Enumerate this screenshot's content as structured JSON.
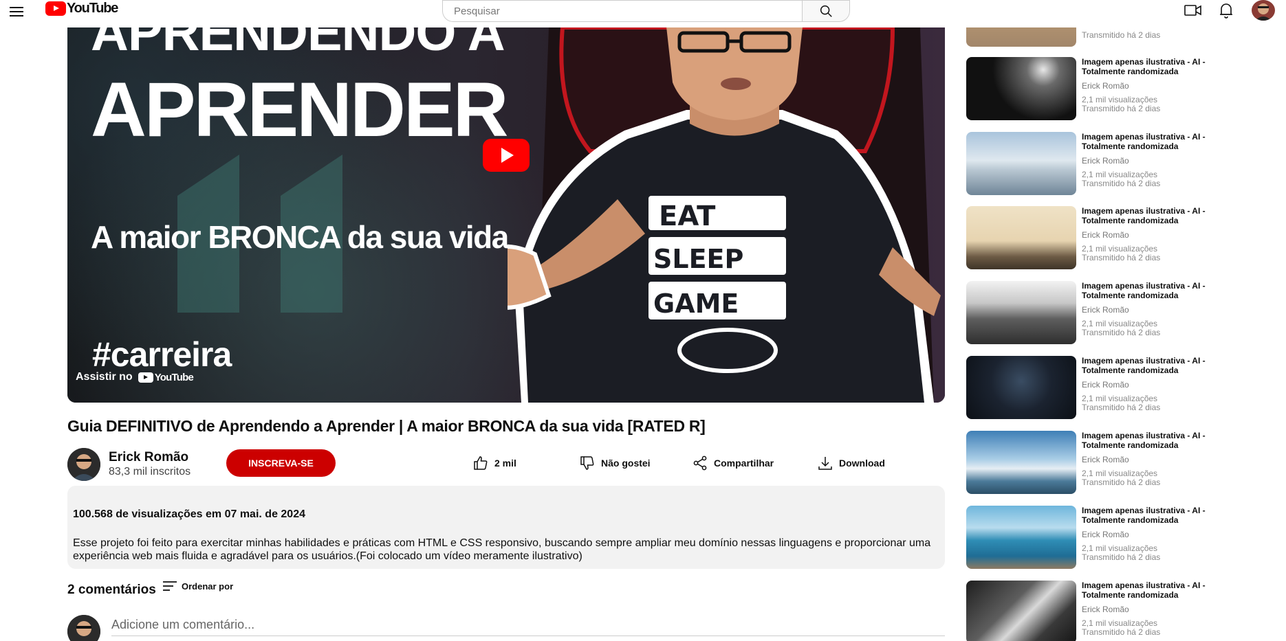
{
  "header": {
    "logo_text": "YouTube",
    "search_placeholder": "Pesquisar"
  },
  "player": {
    "thumb_line1": "APRENDENDO A",
    "thumb_line2": "APRENDER",
    "thumb_subtitle": "A maior BRONCA da sua vida",
    "thumb_hashtag": "#carreira",
    "shirt_text": [
      "EAT",
      "SLEEP",
      "GAME"
    ],
    "watch_on": "Assistir no",
    "watch_on_logo": "YouTube"
  },
  "video": {
    "title": "Guia DEFINITIVO de Aprendendo a Aprender | A maior BRONCA da sua vida [RATED R]",
    "channel_name": "Erick Romão",
    "subscribers": "83,3 mil inscritos",
    "subscribe_label": "INSCREVA-SE",
    "likes": "2 mil",
    "dislike_label": "Não gostei",
    "share_label": "Compartilhar",
    "download_label": "Download"
  },
  "description": {
    "meta": "100.568 de visualizações em 07 mai. de 2024",
    "text": "Esse projeto foi feito para exercitar minhas habilidades e práticas com HTML e CSS responsivo, buscando sempre ampliar meu domínio nessas linguagens e proporcionar uma experiência web mais fluida e agradável para os usuários.(Foi colocado um vídeo meramente ilustrativo)"
  },
  "comments": {
    "count": "2 comentários",
    "sort_label": "Ordenar por",
    "input_placeholder": "Adicione um comentário..."
  },
  "sidebar": {
    "items": [
      {
        "title": "",
        "channel": "",
        "views": "",
        "time": "Transmitido há 2 dias"
      },
      {
        "title": "Imagem apenas ilustrativa - AI - Totalmente randomizada",
        "channel": "Erick Romão",
        "views": "2,1 mil visualizações",
        "time": "Transmitido há 2 dias"
      },
      {
        "title": "Imagem apenas ilustrativa - AI - Totalmente randomizada",
        "channel": "Erick Romão",
        "views": "2,1 mil visualizações",
        "time": "Transmitido há 2 dias"
      },
      {
        "title": "Imagem apenas ilustrativa - AI - Totalmente randomizada",
        "channel": "Erick Romão",
        "views": "2,1 mil visualizações",
        "time": "Transmitido há 2 dias"
      },
      {
        "title": "Imagem apenas ilustrativa - AI - Totalmente randomizada",
        "channel": "Erick Romão",
        "views": "2,1 mil visualizações",
        "time": "Transmitido há 2 dias"
      },
      {
        "title": "Imagem apenas ilustrativa - AI - Totalmente randomizada",
        "channel": "Erick Romão",
        "views": "2,1 mil visualizações",
        "time": "Transmitido há 2 dias"
      },
      {
        "title": "Imagem apenas ilustrativa - AI - Totalmente randomizada",
        "channel": "Erick Romão",
        "views": "2,1 mil visualizações",
        "time": "Transmitido há 2 dias"
      },
      {
        "title": "Imagem apenas ilustrativa - AI - Totalmente randomizada",
        "channel": "Erick Romão",
        "views": "2,1 mil visualizações",
        "time": "Transmitido há 2 dias"
      },
      {
        "title": "Imagem apenas ilustrativa - AI - Totalmente randomizada",
        "channel": "Erick Romão",
        "views": "2,1 mil visualizações",
        "time": "Transmitido há 2 dias"
      }
    ]
  },
  "colors": {
    "brand_red": "#ff0000",
    "subscribe_red": "#cc0000",
    "description_bg": "#f2f2f2"
  }
}
